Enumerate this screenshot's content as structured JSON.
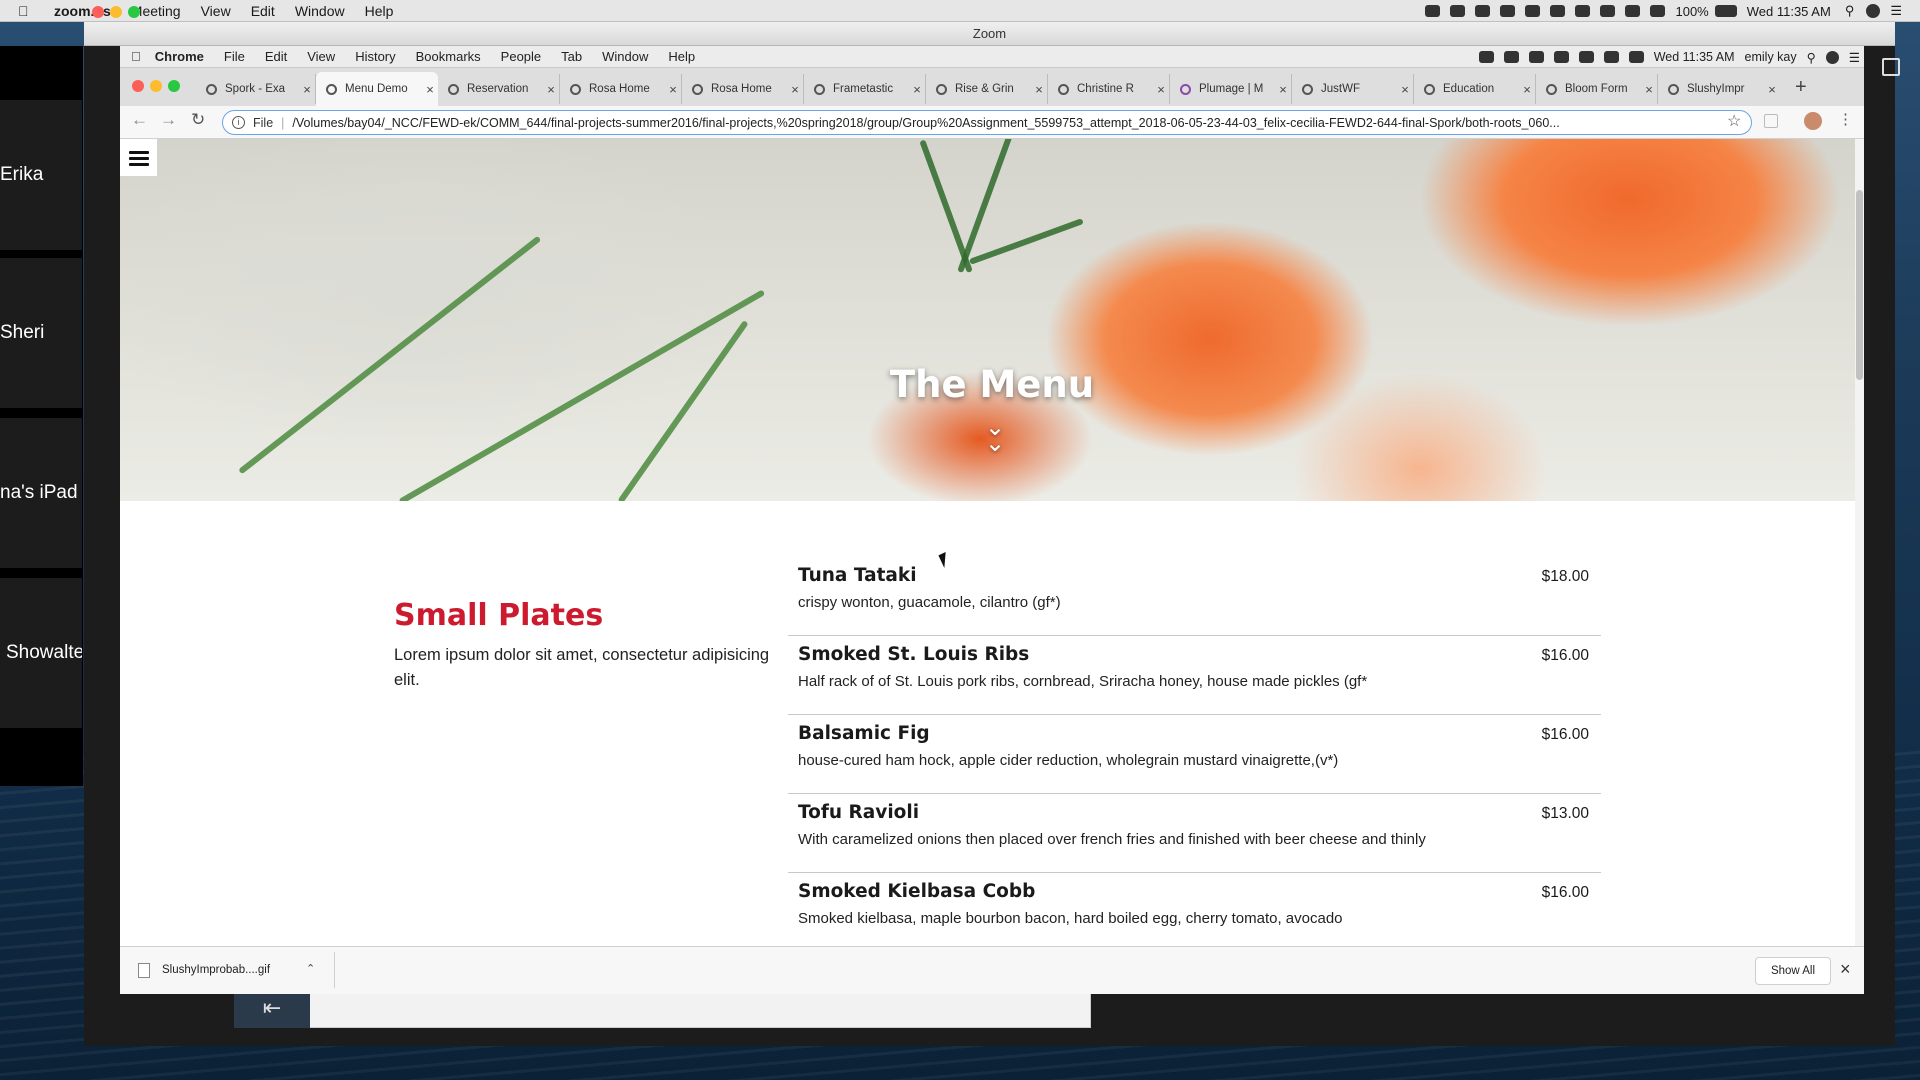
{
  "mac_menubar": {
    "app": "zoom.us",
    "items": [
      "Meeting",
      "View",
      "Edit",
      "Window",
      "Help"
    ],
    "battery": "100%",
    "clock": "Wed 11:35 AM"
  },
  "zoom": {
    "window_title": "Zoom",
    "participants": [
      "Erika",
      "Sheri",
      "na's iPad",
      "Showalte"
    ]
  },
  "chrome_menubar": {
    "apple": "",
    "app": "Chrome",
    "items": [
      "File",
      "Edit",
      "View",
      "History",
      "Bookmarks",
      "People",
      "Tab",
      "Window",
      "Help"
    ],
    "clock": "Wed 11:35 AM",
    "user": "emily kay"
  },
  "tabs": [
    {
      "label": "Spork - Exa"
    },
    {
      "label": "Menu Demo"
    },
    {
      "label": "Reservation"
    },
    {
      "label": "Rosa Home"
    },
    {
      "label": "Rosa Home"
    },
    {
      "label": "Frametastic"
    },
    {
      "label": "Rise & Grin"
    },
    {
      "label": "Christine R"
    },
    {
      "label": "Plumage | M"
    },
    {
      "label": "JustWF"
    },
    {
      "label": "Education"
    },
    {
      "label": "Bloom Form"
    },
    {
      "label": "SlushyImpr"
    }
  ],
  "address_bar": {
    "scheme": "File",
    "url": "/Volumes/bay04/_NCC/FEWD-ek/COMM_644/final-projects-summer2016/final-projects,%20spring2018/group/Group%20Assignment_5599753_attempt_2018-06-05-23-44-03_felix-cecilia-FEWD2-644-final-Spork/both-roots_060..."
  },
  "hero": {
    "title": "The Menu",
    "chevron": "⌄"
  },
  "section": {
    "title": "Small Plates",
    "description": "Lorem ipsum dolor sit amet, consectetur adipisicing elit."
  },
  "menu_items": [
    {
      "name": "Tuna Tataki",
      "price": "$18.00",
      "description": "crispy wonton, guacamole, cilantro (gf*)"
    },
    {
      "name": "Smoked St. Louis Ribs",
      "price": "$16.00",
      "description": "Half rack of of St. Louis pork ribs, cornbread, Sriracha honey, house made pickles (gf*"
    },
    {
      "name": "Balsamic Fig",
      "price": "$16.00",
      "description": "house-cured ham hock, apple cider reduction, wholegrain mustard vinaigrette,(v*)"
    },
    {
      "name": "Tofu Ravioli",
      "price": "$13.00",
      "description": "With caramelized onions then placed over french fries and finished with beer cheese and thinly"
    },
    {
      "name": "Smoked Kielbasa Cobb",
      "price": "$16.00",
      "description": "Smoked kielbasa, maple bourbon bacon, hard boiled egg, cherry tomato, avocado"
    }
  ],
  "download_bar": {
    "file": "SlushyImprobab....gif",
    "show_all": "Show All"
  },
  "colors": {
    "accent_red": "#cc1b2e",
    "omnibox_focus": "#6aa5e8"
  }
}
